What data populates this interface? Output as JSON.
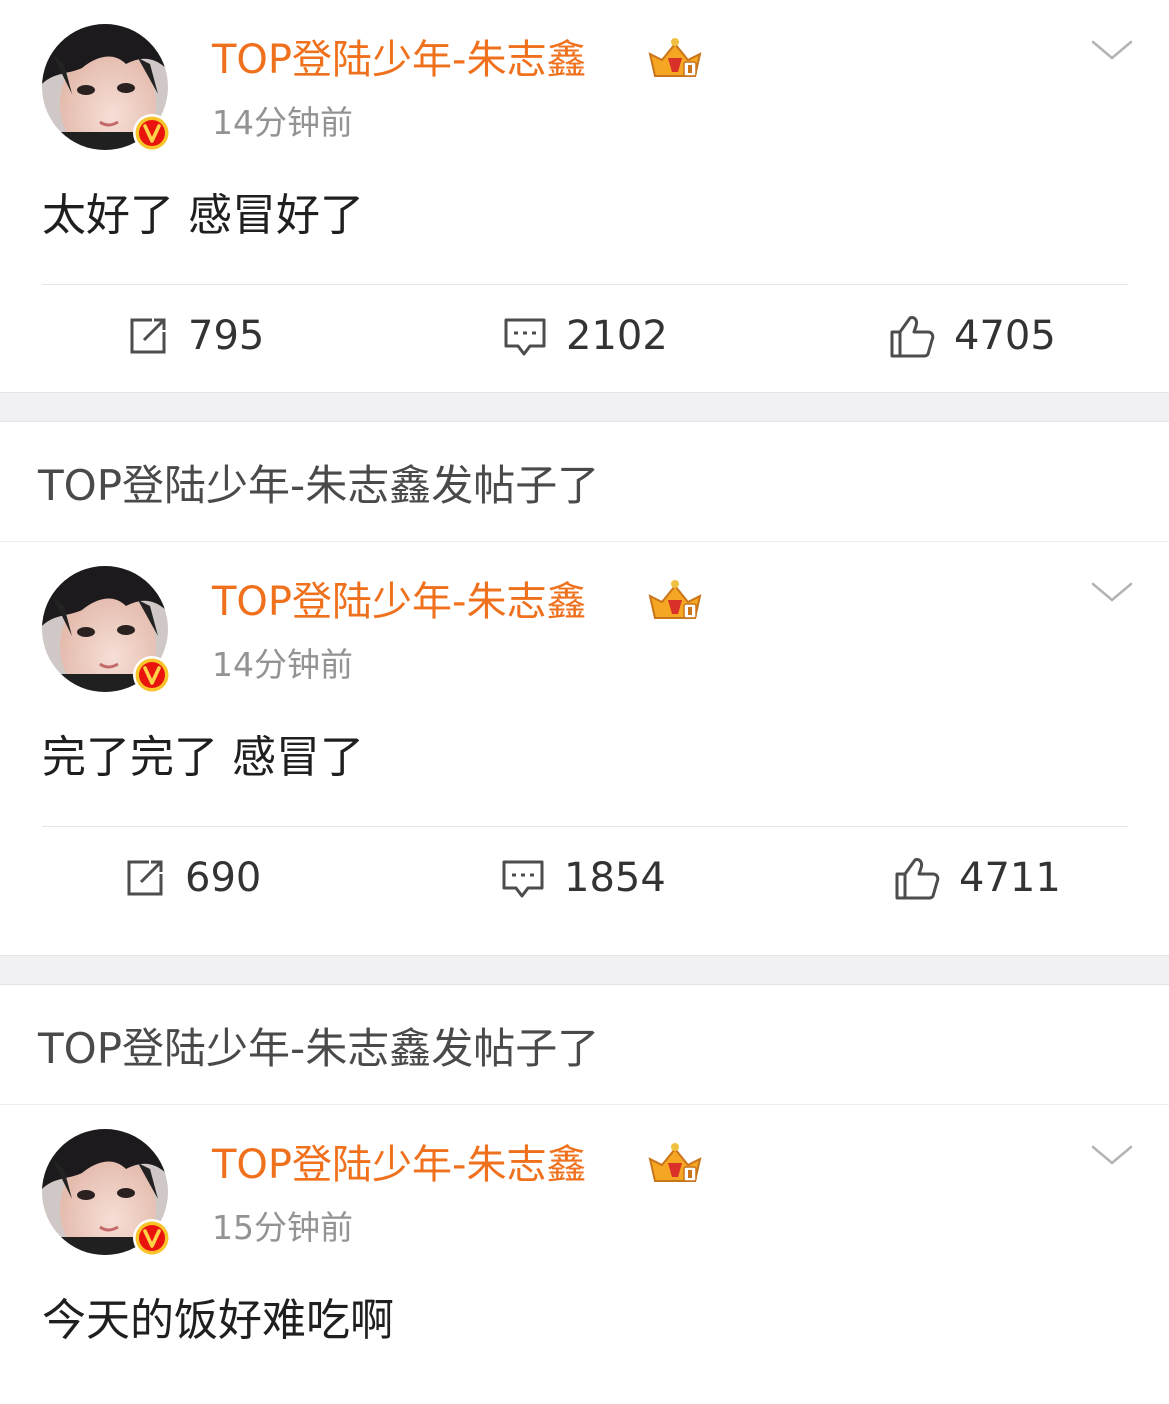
{
  "colors": {
    "username": "#f0711d",
    "timestamp": "#939393",
    "text": "#1f1f1f",
    "separator_bg": "#f1f1f3",
    "verified_badge": "#e8140d",
    "verified_ring": "#f9c32a"
  },
  "posts": [
    {
      "username": "TOP登陆少年-朱志鑫",
      "time": "14分钟前",
      "text": "太好了 感冒好了",
      "reposts": "795",
      "comments": "2102",
      "likes": "4705",
      "icons": [
        "avatar",
        "verified-v-icon",
        "crown-badge-icon",
        "chevron-down-icon",
        "repost-icon",
        "comment-icon",
        "like-icon"
      ]
    },
    {
      "username": "TOP登陆少年-朱志鑫",
      "time": "14分钟前",
      "text": "完了完了 感冒了",
      "reposts": "690",
      "comments": "1854",
      "likes": "4711",
      "icons": [
        "avatar",
        "verified-v-icon",
        "crown-badge-icon",
        "chevron-down-icon",
        "repost-icon",
        "comment-icon",
        "like-icon"
      ]
    },
    {
      "username": "TOP登陆少年-朱志鑫",
      "time": "15分钟前",
      "text": "今天的饭好难吃啊",
      "icons": [
        "avatar",
        "verified-v-icon",
        "crown-badge-icon",
        "chevron-down-icon"
      ]
    }
  ],
  "notices": [
    "TOP登陆少年-朱志鑫发帖子了",
    "TOP登陆少年-朱志鑫发帖子了"
  ],
  "badge_letter": "V"
}
